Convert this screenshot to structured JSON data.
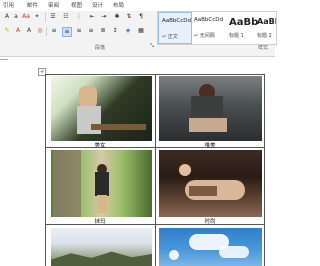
{
  "ribbon": {
    "tabs": [
      "引用",
      "邮件",
      "审阅",
      "视图",
      "设计",
      "布局"
    ],
    "paragraph_group": "段落",
    "styles_group": "样式",
    "styles": [
      {
        "sample": "AaBbCcDd",
        "name": "正文",
        "active": true
      },
      {
        "sample": "AaBbCcDd",
        "name": "无间隔",
        "active": false
      },
      {
        "sample": "AaBb",
        "name": "标题 1",
        "active": false
      },
      {
        "sample": "AaBl",
        "name": "标题 2",
        "active": false
      }
    ]
  },
  "document": {
    "captions": [
      "美女",
      "唯美",
      "抹玛",
      "时尚"
    ]
  }
}
